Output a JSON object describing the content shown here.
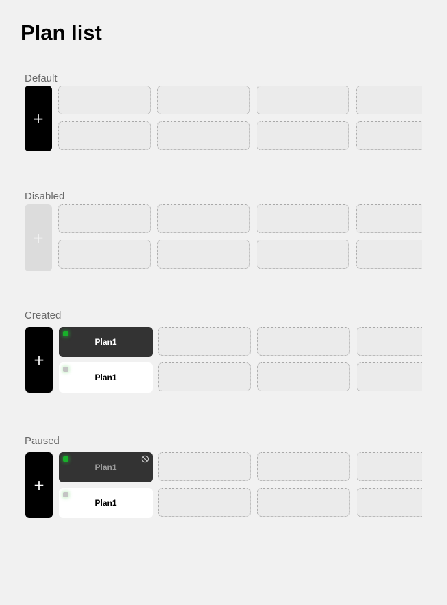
{
  "page": {
    "title": "Plan list"
  },
  "add_icon": "plus-icon",
  "sections": [
    {
      "label": "Default",
      "state": "default",
      "plans": []
    },
    {
      "label": "Disabled",
      "state": "disabled",
      "plans": []
    },
    {
      "label": "Created",
      "state": "created",
      "plans": [
        {
          "name": "Plan1",
          "style": "dark",
          "status": "green"
        },
        {
          "name": "Plan1",
          "style": "light",
          "status": "grey"
        }
      ]
    },
    {
      "label": "Paused",
      "state": "paused",
      "plans": [
        {
          "name": "Plan1",
          "style": "dark",
          "status": "green",
          "paused_icon": "paused-icon"
        },
        {
          "name": "Plan1",
          "style": "light",
          "status": "grey"
        }
      ]
    }
  ],
  "colors": {
    "background": "#f1f1f1",
    "add_button": "#000000",
    "add_button_disabled": "#dcdcdc",
    "plan_dark": "#333333",
    "plan_light": "#ffffff",
    "status_active": "#18b02a",
    "status_inactive": "#c4c4c4"
  }
}
